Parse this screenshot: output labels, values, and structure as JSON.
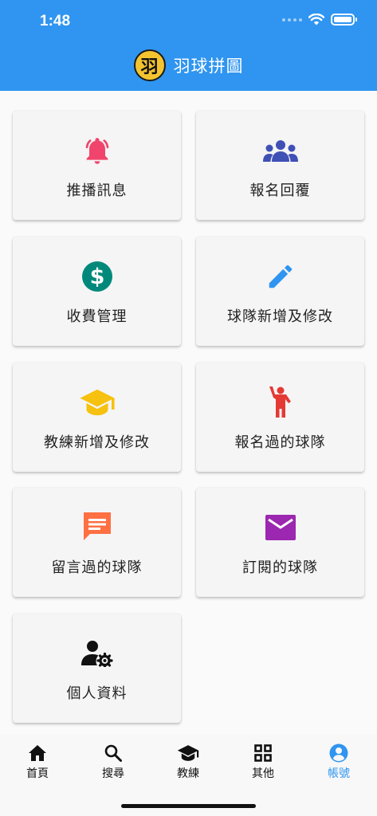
{
  "status_bar": {
    "time": "1:48"
  },
  "header": {
    "logo_char": "羽",
    "title": "羽球拼圖"
  },
  "menu": {
    "items": [
      {
        "label": "推播訊息",
        "icon": "bell-icon",
        "color": "#f1446c"
      },
      {
        "label": "報名回覆",
        "icon": "group-icon",
        "color": "#3f51b5"
      },
      {
        "label": "收費管理",
        "icon": "dollar-icon",
        "color": "#00897b"
      },
      {
        "label": "球隊新增及修改",
        "icon": "pencil-icon",
        "color": "#2f95f0"
      },
      {
        "label": "教練新增及修改",
        "icon": "graduation-cap-icon",
        "color": "#f6c10f"
      },
      {
        "label": "報名過的球隊",
        "icon": "person-raising-hand-icon",
        "color": "#e53935"
      },
      {
        "label": "留言過的球隊",
        "icon": "chat-icon",
        "color": "#ff7043"
      },
      {
        "label": "訂閱的球隊",
        "icon": "mail-icon",
        "color": "#9c27b0"
      },
      {
        "label": "個人資料",
        "icon": "user-settings-icon",
        "color": "#111111"
      }
    ]
  },
  "bottom_nav": {
    "active_color": "#2f95f0",
    "items": [
      {
        "label": "首頁",
        "icon": "home-icon"
      },
      {
        "label": "搜尋",
        "icon": "search-icon"
      },
      {
        "label": "教練",
        "icon": "graduation-cap-icon"
      },
      {
        "label": "其他",
        "icon": "grid-icon"
      },
      {
        "label": "帳號",
        "icon": "account-circle-icon",
        "active": true
      }
    ]
  }
}
